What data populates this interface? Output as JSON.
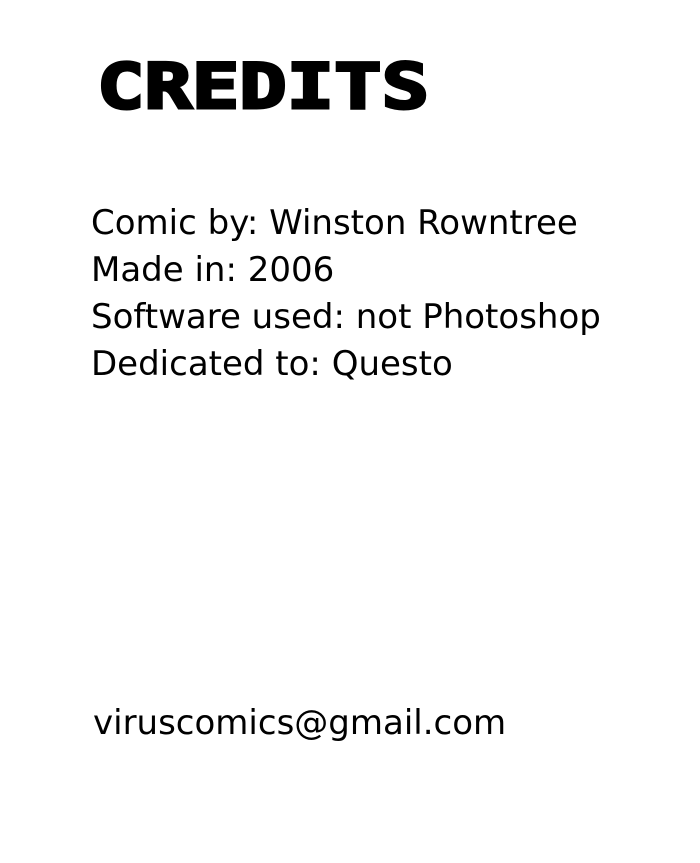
{
  "page": {
    "title": "CREDITS",
    "credits": [
      "Comic by: Winston Rowntree",
      "Made in: 2006",
      "Software used: not Photoshop",
      "Dedicated to: Questo"
    ],
    "email": "viruscomics@gmail.com"
  }
}
